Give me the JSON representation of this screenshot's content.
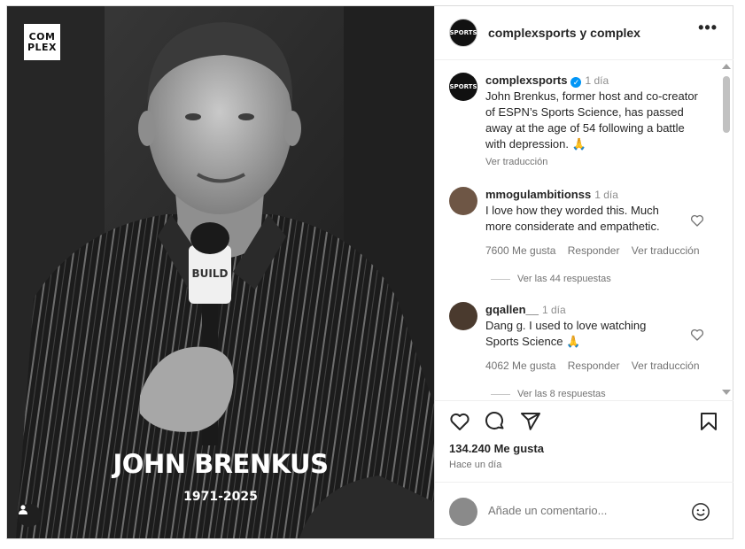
{
  "post": {
    "logo_line1": "COM",
    "logo_line2": "PLEX",
    "caption_name": "JOHN BRENKUS",
    "caption_years": "1971-2025",
    "mic_text": "BUILD"
  },
  "header": {
    "title": "complexsports y complex",
    "avatar_text": "SPORTS",
    "more": "•••"
  },
  "caption": {
    "username": "complexsports",
    "time": "1 día",
    "text": "John Brenkus, former host and co-creator of ESPN’s Sports Science, has passed away at the age of 54 following a battle with depression. 🙏",
    "translate": "Ver traducción"
  },
  "comments": [
    {
      "username": "mmogulambitionss",
      "time": "1 día",
      "text": "I love how they worded this. Much more considerate and empathetic.",
      "likes": "7600 Me gusta",
      "reply": "Responder",
      "translate": "Ver traducción",
      "replies": "Ver las 44 respuestas"
    },
    {
      "username": "gqallen__",
      "time": "1 día",
      "text": "Dang g. I used to love watching Sports Science 🙏",
      "likes": "4062 Me gusta",
      "reply": "Responder",
      "translate": "Ver traducción",
      "replies": "Ver las 8 respuestas"
    }
  ],
  "footer": {
    "likes": "134.240 Me gusta",
    "ago": "Hace un día",
    "add_comment_placeholder": "Añade un comentario..."
  },
  "icons": {
    "like": "heart-icon",
    "comment": "comment-icon",
    "share": "share-icon",
    "save": "bookmark-icon",
    "emoji": "emoji-icon"
  }
}
